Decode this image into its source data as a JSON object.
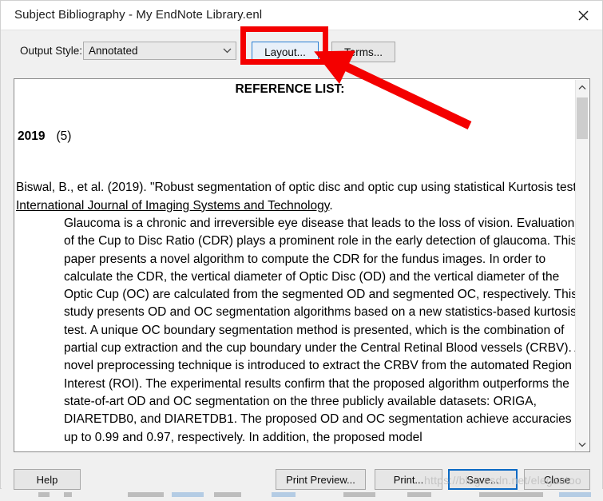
{
  "window": {
    "title": "Subject Bibliography - My EndNote Library.enl",
    "close_icon": "close-icon"
  },
  "toolbar": {
    "output_style_label": "Output Style:",
    "output_style_value": "Annotated",
    "output_style_arrow_icon": "chevron-down-icon",
    "layout_button": "Layout...",
    "terms_button": "Terms..."
  },
  "preview": {
    "heading": "REFERENCE LIST:",
    "year": "2019",
    "count": "(5)",
    "citation": {
      "prefix": "Biswal, B., et al. (2019). \"Robust segmentation of optic disc and optic cup using statistical Kurtosis test.\" ",
      "journal": "International Journal of Imaging Systems and Technology",
      "suffix": "."
    },
    "abstract": "Glaucoma is a chronic and irreversible eye disease that leads to the loss of vision. Evaluation of the Cup to Disc Ratio (CDR) plays a prominent role in the early detection of glaucoma. This paper presents a novel algorithm to compute the CDR for the fundus images. In order to calculate the CDR, the vertical diameter of Optic Disc (OD) and the vertical diameter of the Optic Cup (OC) are calculated from the segmented OD and segmented OC, respectively. This study presents OD and OC segmentation algorithms based on a new statistics-based kurtosis test. A unique OC boundary segmentation method is presented, which is the combination of partial cup extraction and the cup boundary under the Central Retinal Blood vessels (CRBV). A novel preprocessing technique is introduced to extract the CRBV from the automated Region of Interest (ROI). The experimental results confirm that the proposed algorithm outperforms the state-of-art OD and OC segmentation on the three publicly available datasets: ORIGA, DIARETDB0, and DIARETDB1. The proposed OD and OC segmentation achieve accuracies of up to 0.99 and 0.97, respectively. In addition, the proposed model"
  },
  "scrollbar": {
    "up_icon": "chevron-up-icon",
    "down_icon": "chevron-down-icon",
    "thumb": "scroll-thumb"
  },
  "footer": {
    "help": "Help",
    "print_preview": "Print Preview...",
    "print": "Print...",
    "save": "Save...",
    "close": "Close"
  },
  "watermark": {
    "text": "https://blog.csdn.net/elegantoo"
  },
  "annotation": {
    "highlight_color": "#f40000",
    "target": "layout-button"
  }
}
